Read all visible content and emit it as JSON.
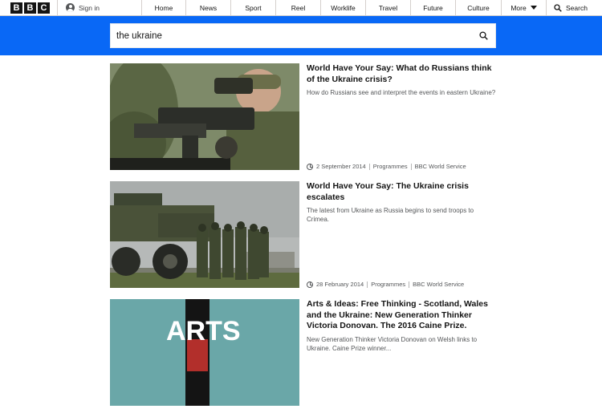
{
  "nav": {
    "logo_letters": [
      "B",
      "B",
      "C"
    ],
    "sign_in": "Sign in",
    "items": [
      "Home",
      "News",
      "Sport",
      "Reel",
      "Worklife",
      "Travel",
      "Future",
      "Culture"
    ],
    "more": "More",
    "search": "Search"
  },
  "search": {
    "query": "the ukraine"
  },
  "results": [
    {
      "title": "World Have Your Say: What do Russians think of the Ukraine crisis?",
      "description": "How do Russians see and interpret the events in eastern Ukraine?",
      "date": "2 September 2014",
      "type": "Programmes",
      "service": "BBC World Service",
      "image": "soldier-aiming-rifle"
    },
    {
      "title": "World Have Your Say: The Ukraine crisis escalates",
      "description": "The latest from Ukraine as Russia begins to send troops to Crimea.",
      "date": "28 February 2014",
      "type": "Programmes",
      "service": "BBC World Service",
      "image": "military-truck-and-troops"
    },
    {
      "title": "Arts & Ideas: Free Thinking - Scotland, Wales and the Ukraine: New Generation Thinker Victoria Donovan. The 2016 Caine Prize.",
      "description": "New Generation Thinker Victoria Donovan on Welsh links to Ukraine. Caine Prize winner...",
      "image": "arts-and-ideas-logo",
      "image_text": "ARTS"
    }
  ],
  "colors": {
    "band": "#0968f6",
    "text": "#141414",
    "muted": "#545658"
  }
}
